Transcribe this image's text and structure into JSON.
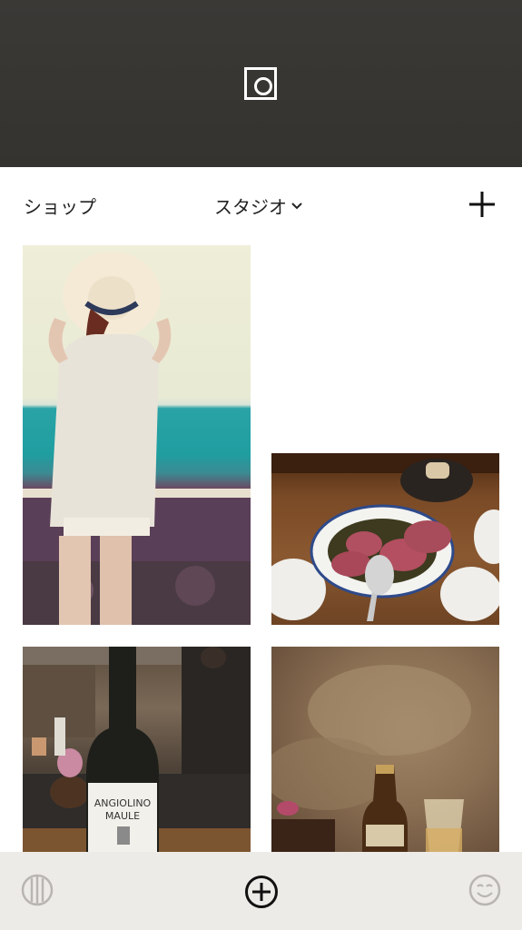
{
  "nav": {
    "left_label": "ショップ",
    "center_label": "スタジオ"
  },
  "icons": {
    "header": "shutter-icon",
    "nav_right": "plus-icon",
    "nav_center": "chevron-down-icon",
    "tabs": [
      "columns-icon",
      "add-circle-icon",
      "smile-face-icon"
    ]
  },
  "colors": {
    "header_background": "#35332f",
    "text": "#222222",
    "tab_bar_background": "#ece9e5",
    "tab_inactive_icon": "#b8b5b2"
  },
  "photos": [
    {
      "subject": "woman-in-sun-hat"
    },
    {
      "subject": "steak-plate"
    },
    {
      "subject": "wine-bottle"
    },
    {
      "subject": "beer-bottle-wall"
    }
  ]
}
